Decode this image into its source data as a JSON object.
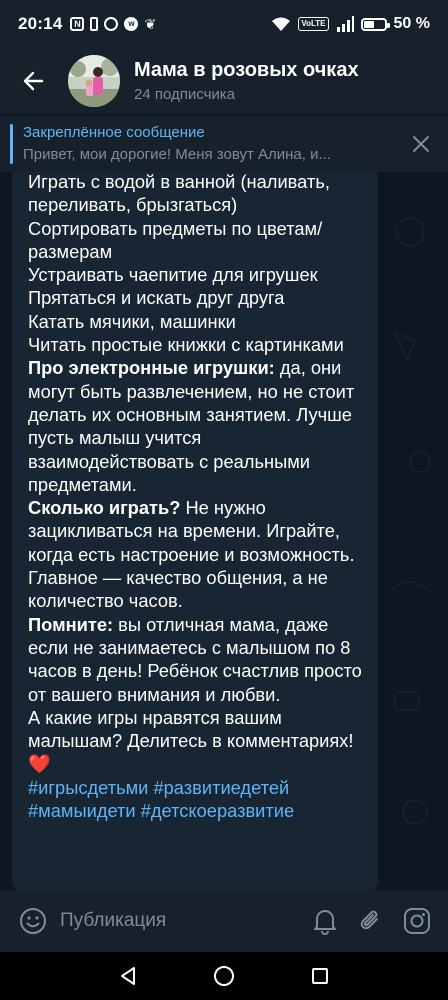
{
  "status_bar": {
    "time": "20:14",
    "left_icons": [
      "nfc-icon",
      "vibrate-icon",
      "timer-icon",
      "vk-icon",
      "leaf-icon"
    ],
    "volte": "VoLTE",
    "battery_percent": "50 %",
    "battery_level": 0.5
  },
  "header": {
    "title": "Мама в розовых очках",
    "subtitle": "24 подписчика"
  },
  "pinned": {
    "title": "Закреплённое сообщение",
    "body": "Привет, мои дорогие! Меня зовут Алина, и..."
  },
  "message": {
    "lines": [
      {
        "bold": "",
        "text": "Играть с водой в ванной (наливать, переливать, брызгаться)"
      },
      {
        "bold": "",
        "text": "Сортировать предметы по цветам/размерам"
      },
      {
        "bold": "",
        "text": "Устраивать чаепитие для игрушек"
      },
      {
        "bold": "",
        "text": "Прятаться и искать друг друга"
      },
      {
        "bold": "",
        "text": "Катать мячики, машинки"
      },
      {
        "bold": "",
        "text": "Читать простые книжки с картинками"
      },
      {
        "bold": "Про электронные игрушки:",
        "text": " да, они могут быть развлечением, но не стоит делать их основным занятием. Лучше пусть малыш учится взаимодействовать с реальными предметами."
      },
      {
        "bold": "Сколько играть?",
        "text": " Не нужно зацикливаться на времени. Играйте, когда есть настроение и возможность. Главное — качество общения, а не количество часов."
      },
      {
        "bold": "Помните:",
        "text": " вы отличная мама, даже если не занимаетесь с малышом по 8 часов в день! Ребёнок счастлив просто от вашего внимания и любви."
      },
      {
        "bold": "",
        "text": "А какие игры нравятся вашим малышам? Делитесь в комментариях! ❤️"
      }
    ],
    "hashtags": "#игрысдетьми #развитиедетей #мамыидети #детскоеразвитие"
  },
  "input_bar": {
    "placeholder": "Публикация",
    "icons": [
      "emoji-icon",
      "bell-icon",
      "paperclip-icon",
      "instagram-icon"
    ]
  },
  "nav_bar": {
    "buttons": [
      "back-triangle-icon",
      "home-circle-icon",
      "recents-square-icon"
    ]
  },
  "colors": {
    "accent": "#5eb5f7",
    "bubble": "#182533",
    "header_bg": "#17212b",
    "chat_bg": "#0e1621",
    "muted": "#7f8c99"
  }
}
